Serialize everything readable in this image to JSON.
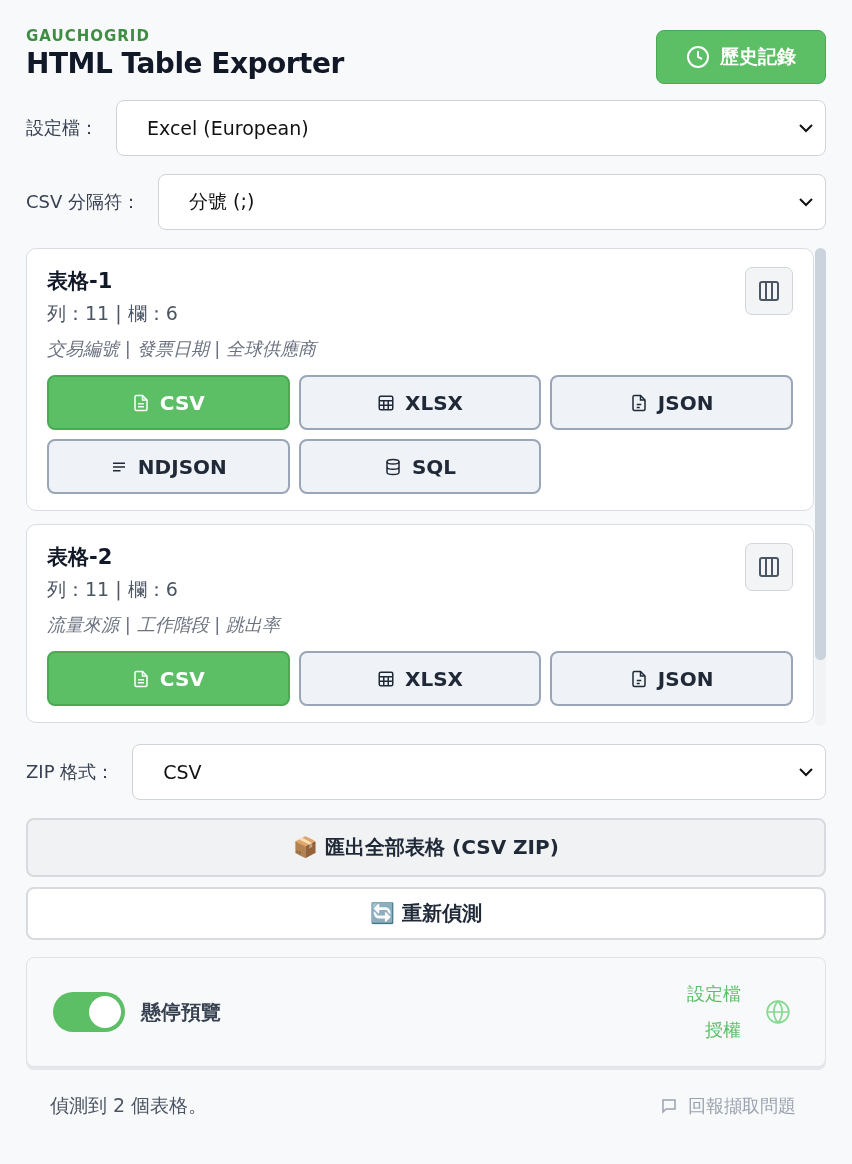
{
  "header": {
    "brand": "GAUCHOGRID",
    "title": "HTML Table Exporter",
    "history_button": "歷史記錄"
  },
  "profile": {
    "label": "設定檔：",
    "value": "Excel (European)"
  },
  "delimiter": {
    "label": "CSV 分隔符：",
    "value": "分號 (;)"
  },
  "tables": [
    {
      "name": "表格-1",
      "stats": "列：11 | 欄：6",
      "headers": "交易編號 | 發票日期 | 全球供應商",
      "formats": [
        {
          "label": "CSV",
          "kind": "file",
          "selected": true
        },
        {
          "label": "XLSX",
          "kind": "grid",
          "selected": false
        },
        {
          "label": "JSON",
          "kind": "doc",
          "selected": false
        },
        {
          "label": "NDJSON",
          "kind": "lines",
          "selected": false
        },
        {
          "label": "SQL",
          "kind": "database",
          "selected": false
        }
      ]
    },
    {
      "name": "表格-2",
      "stats": "列：11 | 欄：6",
      "headers": "流量來源 | 工作階段 | 跳出率",
      "formats": [
        {
          "label": "CSV",
          "kind": "file",
          "selected": true
        },
        {
          "label": "XLSX",
          "kind": "grid",
          "selected": false
        },
        {
          "label": "JSON",
          "kind": "doc",
          "selected": false
        }
      ]
    }
  ],
  "zip": {
    "label": "ZIP 格式：",
    "value": "CSV"
  },
  "export_all_button": "📦 匯出全部表格 (CSV ZIP)",
  "redetect_button": "🔄 重新偵測",
  "settings_panel": {
    "hover_preview": {
      "label": "懸停預覽",
      "on": true
    },
    "links": [
      "設定檔",
      "授權"
    ]
  },
  "status_bar": {
    "message": "偵測到 2 個表格。",
    "report_link": "回報擷取問題"
  }
}
